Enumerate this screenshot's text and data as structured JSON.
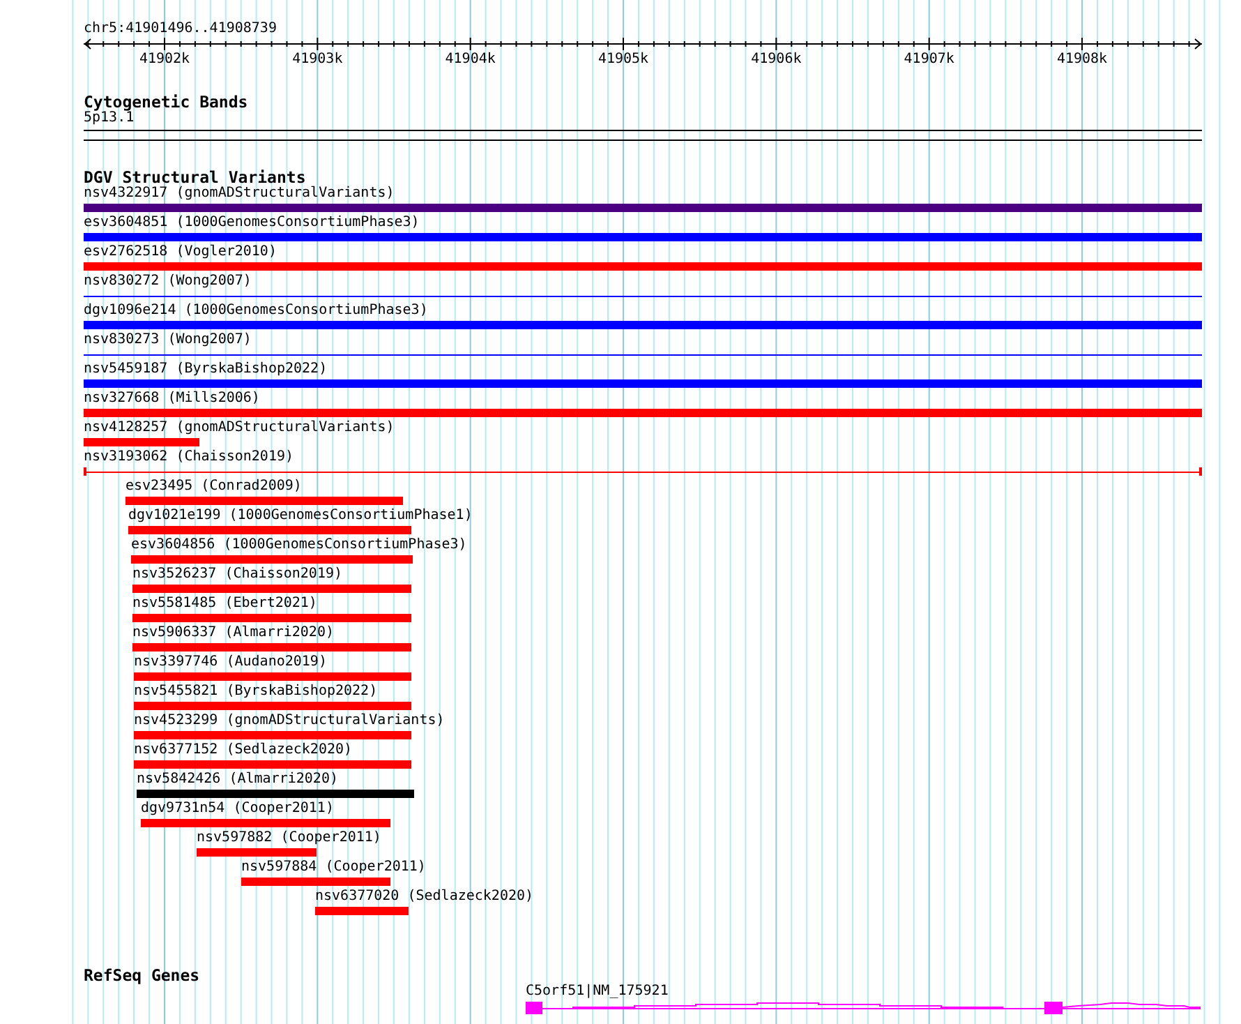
{
  "ruler": {
    "location": "chr5:41901496..41908739",
    "ticks": [
      "41902k",
      "41903k",
      "41904k",
      "41905k",
      "41906k",
      "41907k",
      "41908k"
    ]
  },
  "tracks": [
    {
      "kind": "bands",
      "title": "Cytogenetic Bands",
      "items": [
        {
          "label": "5p13.1"
        }
      ]
    },
    {
      "kind": "variants",
      "title": "DGV Structural Variants",
      "items": [
        {
          "label": "nsv4322917 (gnomADStructuralVariants)",
          "color": "#4b0082",
          "kind": "bar"
        },
        {
          "label": "esv3604851 (1000GenomesConsortiumPhase3)",
          "color": "#0000ff",
          "kind": "bar"
        },
        {
          "label": "esv2762518 (Vogler2010)",
          "color": "#ff0000",
          "kind": "bar"
        },
        {
          "label": "nsv830272 (Wong2007)",
          "color": "#0000ff",
          "kind": "line"
        },
        {
          "label": "dgv1096e214 (1000GenomesConsortiumPhase3)",
          "color": "#0000ff",
          "kind": "bar"
        },
        {
          "label": "nsv830273 (Wong2007)",
          "color": "#0000ff",
          "kind": "line"
        },
        {
          "label": "nsv5459187 (ByrskaBishop2022)",
          "color": "#0000ff",
          "kind": "bar"
        },
        {
          "label": "nsv327668 (Mills2006)",
          "color": "#ff0000",
          "kind": "bar"
        },
        {
          "label": "nsv4128257 (gnomADStructuralVariants)",
          "color": "#ff0000",
          "kind": "bar"
        },
        {
          "label": "nsv3193062 (Chaisson2019)",
          "color": "#ff0000",
          "kind": "span"
        },
        {
          "label": "esv23495 (Conrad2009)",
          "color": "#ff0000",
          "kind": "bar"
        },
        {
          "label": "dgv1021e199 (1000GenomesConsortiumPhase1)",
          "color": "#ff0000",
          "kind": "bar"
        },
        {
          "label": "esv3604856 (1000GenomesConsortiumPhase3)",
          "color": "#ff0000",
          "kind": "bar"
        },
        {
          "label": "nsv3526237 (Chaisson2019)",
          "color": "#ff0000",
          "kind": "bar"
        },
        {
          "label": "nsv5581485 (Ebert2021)",
          "color": "#ff0000",
          "kind": "bar"
        },
        {
          "label": "nsv5906337 (Almarri2020)",
          "color": "#ff0000",
          "kind": "bar"
        },
        {
          "label": "nsv3397746 (Audano2019)",
          "color": "#ff0000",
          "kind": "bar"
        },
        {
          "label": "nsv5455821 (ByrskaBishop2022)",
          "color": "#ff0000",
          "kind": "bar"
        },
        {
          "label": "nsv4523299 (gnomADStructuralVariants)",
          "color": "#ff0000",
          "kind": "bar"
        },
        {
          "label": "nsv6377152 (Sedlazeck2020)",
          "color": "#ff0000",
          "kind": "bar"
        },
        {
          "label": "nsv5842426 (Almarri2020)",
          "color": "#000000",
          "kind": "bar"
        },
        {
          "label": "dgv9731n54 (Cooper2011)",
          "color": "#ff0000",
          "kind": "bar"
        },
        {
          "label": "nsv597882 (Cooper2011)",
          "color": "#ff0000",
          "kind": "bar"
        },
        {
          "label": "nsv597884 (Cooper2011)",
          "color": "#ff0000",
          "kind": "bar"
        },
        {
          "label": "nsv6377020 (Sedlazeck2020)",
          "color": "#ff0000",
          "kind": "bar"
        }
      ]
    },
    {
      "kind": "genes",
      "title": "RefSeq Genes",
      "items": [
        {
          "label": "C5orf51|NM_175921"
        }
      ]
    }
  ]
}
